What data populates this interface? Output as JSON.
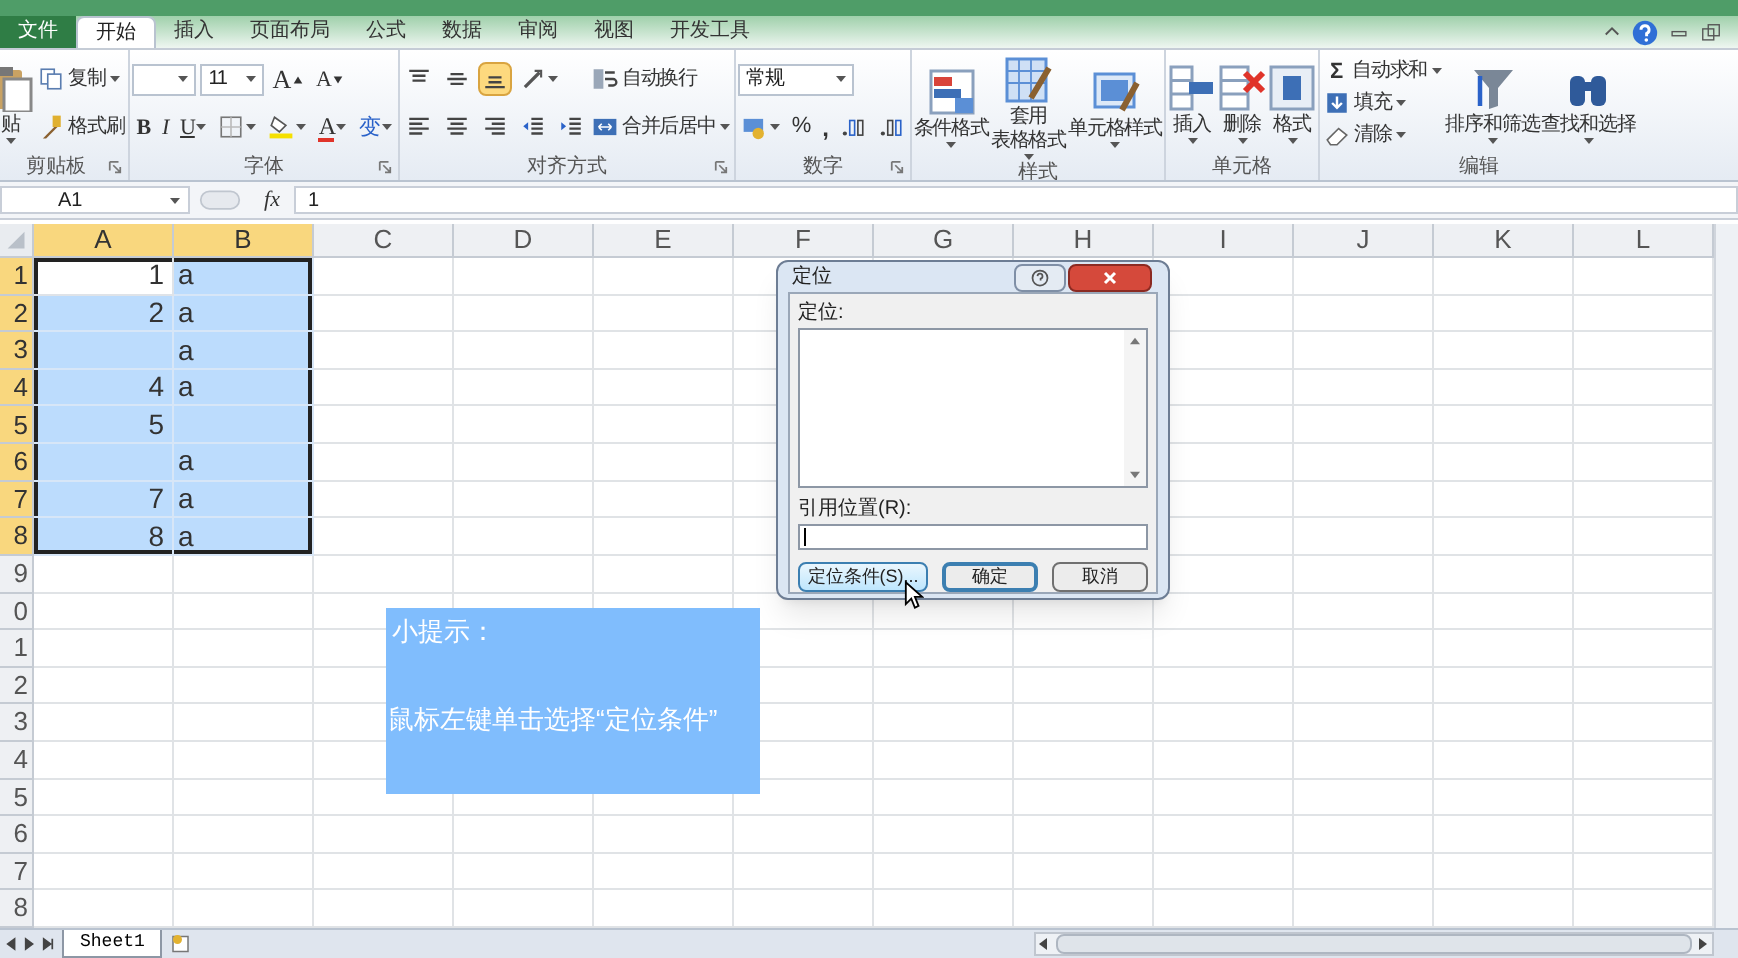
{
  "tabs": [
    {
      "label": "文件",
      "kind": "file",
      "selected": false
    },
    {
      "label": "开始",
      "kind": "tab",
      "selected": true
    },
    {
      "label": "插入",
      "kind": "tab",
      "selected": false
    },
    {
      "label": "页面布局",
      "kind": "tab",
      "selected": false
    },
    {
      "label": "公式",
      "kind": "tab",
      "selected": false
    },
    {
      "label": "数据",
      "kind": "tab",
      "selected": false
    },
    {
      "label": "审阅",
      "kind": "tab",
      "selected": false
    },
    {
      "label": "视图",
      "kind": "tab",
      "selected": false
    },
    {
      "label": "开发工具",
      "kind": "tab",
      "selected": false
    }
  ],
  "ribbon_groups": [
    {
      "label": "剪贴板",
      "launcher": true,
      "columns": [
        [
          [
            {
              "kind": "big",
              "label": "贴",
              "menu": true
            }
          ]
        ],
        [
          [
            {
              "kind": "small",
              "label": "复制",
              "menu": true
            }
          ],
          [
            {
              "kind": "small",
              "label": "格式刷",
              "menu": false
            }
          ]
        ]
      ]
    },
    {
      "label": "字体",
      "launcher": true,
      "columns": [
        [
          [
            {
              "kind": "field",
              "menu": true
            },
            {
              "kind": "field",
              "value": "11",
              "menu": true
            },
            {
              "kind": "glyph",
              "label": "A",
              "menu": false
            },
            {
              "kind": "glyph",
              "label": "A",
              "menu": false
            }
          ],
          [
            {
              "kind": "glyph",
              "label": "B",
              "menu": false
            },
            {
              "kind": "glyph",
              "label": "I",
              "menu": false
            },
            {
              "kind": "glyph",
              "label": "U",
              "menu": true
            },
            {
              "kind": "icon",
              "menu": true
            },
            {
              "kind": "icon",
              "menu": true
            },
            {
              "kind": "glyph",
              "label": "A",
              "menu": true
            },
            {
              "kind": "glyph",
              "label": "变",
              "menu": true
            }
          ]
        ]
      ]
    },
    {
      "label": "对齐方式",
      "launcher": true,
      "columns": [
        [
          [
            {
              "kind": "icon",
              "menu": false,
              "on": false
            },
            {
              "kind": "icon",
              "menu": false,
              "on": false
            },
            {
              "kind": "icon",
              "menu": false,
              "on": true
            },
            {
              "kind": "icon",
              "menu": true,
              "on": false
            }
          ],
          [
            {
              "kind": "icon",
              "menu": false,
              "on": false
            },
            {
              "kind": "icon",
              "menu": false,
              "on": false
            },
            {
              "kind": "icon",
              "menu": false,
              "on": false
            },
            {
              "kind": "icon",
              "menu": false,
              "on": false
            },
            {
              "kind": "icon",
              "menu": false,
              "on": false
            }
          ]
        ],
        [
          [
            {
              "kind": "small",
              "label": "自动换行",
              "menu": false
            }
          ],
          [
            {
              "kind": "small",
              "label": "合并后居中",
              "menu": true
            }
          ]
        ]
      ]
    },
    {
      "label": "数字",
      "launcher": true,
      "columns": [
        [
          [
            {
              "kind": "field",
              "value": "常规",
              "menu": true
            }
          ],
          [
            {
              "kind": "icon",
              "menu": true
            },
            {
              "kind": "glyph",
              "label": "%",
              "menu": false
            },
            {
              "kind": "glyph",
              "label": ",",
              "menu": false
            },
            {
              "kind": "icon",
              "menu": false
            },
            {
              "kind": "icon",
              "menu": false
            }
          ]
        ]
      ]
    },
    {
      "label": "样式",
      "launcher": false,
      "columns": [
        [
          [
            {
              "kind": "big",
              "label": "条件格式",
              "menu": true
            }
          ]
        ],
        [
          [
            {
              "kind": "big",
              "label": [
                "套用",
                "表格格式"
              ],
              "menu": true
            }
          ]
        ],
        [
          [
            {
              "kind": "big",
              "label": "单元格样式",
              "menu": true
            }
          ]
        ]
      ]
    },
    {
      "label": "单元格",
      "launcher": false,
      "columns": [
        [
          [
            {
              "kind": "big",
              "label": "插入",
              "menu": true
            }
          ]
        ],
        [
          [
            {
              "kind": "big",
              "label": "删除",
              "menu": true
            }
          ]
        ],
        [
          [
            {
              "kind": "big",
              "label": "格式",
              "menu": true
            }
          ]
        ]
      ]
    },
    {
      "label": "编辑",
      "launcher": false,
      "columns": [
        [
          [
            {
              "kind": "small",
              "glyph": "Σ",
              "label": "自动求和",
              "menu": true
            }
          ],
          [
            {
              "kind": "small",
              "label": "填充",
              "menu": true
            }
          ],
          [
            {
              "kind": "small",
              "label": "清除",
              "menu": true
            }
          ]
        ],
        [
          [
            {
              "kind": "big",
              "label": "排序和筛选",
              "menu": true
            }
          ]
        ],
        [
          [
            {
              "kind": "big",
              "label": "查找和选择",
              "menu": true
            }
          ]
        ]
      ]
    }
  ],
  "formula_bar": {
    "name_box": "A1",
    "fx": "fx",
    "value": "1"
  },
  "columns": [
    {
      "label": "A",
      "selected": true
    },
    {
      "label": "B",
      "selected": true
    },
    {
      "label": "C",
      "selected": false
    },
    {
      "label": "D",
      "selected": false
    },
    {
      "label": "E",
      "selected": false
    },
    {
      "label": "F",
      "selected": false
    },
    {
      "label": "G",
      "selected": false
    },
    {
      "label": "H",
      "selected": false
    },
    {
      "label": "I",
      "selected": false
    },
    {
      "label": "J",
      "selected": false
    },
    {
      "label": "K",
      "selected": false
    },
    {
      "label": "L",
      "selected": false
    }
  ],
  "rows": [
    {
      "header": "1",
      "selected": true,
      "cells": [
        {
          "value": "1",
          "kind": "number",
          "selected": true,
          "active": true
        },
        {
          "value": "a",
          "kind": "text",
          "selected": true,
          "active": false
        }
      ]
    },
    {
      "header": "2",
      "selected": true,
      "cells": [
        {
          "value": "2",
          "kind": "number",
          "selected": true,
          "active": false
        },
        {
          "value": "a",
          "kind": "text",
          "selected": true,
          "active": false
        }
      ]
    },
    {
      "header": "3",
      "selected": true,
      "cells": [
        {
          "selected": true,
          "active": false
        },
        {
          "value": "a",
          "kind": "text",
          "selected": true,
          "active": false
        }
      ]
    },
    {
      "header": "4",
      "selected": true,
      "cells": [
        {
          "value": "4",
          "kind": "number",
          "selected": true,
          "active": false
        },
        {
          "value": "a",
          "kind": "text",
          "selected": true,
          "active": false
        }
      ]
    },
    {
      "header": "5",
      "selected": true,
      "cells": [
        {
          "value": "5",
          "kind": "number",
          "selected": true,
          "active": false
        },
        {
          "selected": true,
          "active": false
        }
      ]
    },
    {
      "header": "6",
      "selected": true,
      "cells": [
        {
          "selected": true,
          "active": false
        },
        {
          "value": "a",
          "kind": "text",
          "selected": true,
          "active": false
        }
      ]
    },
    {
      "header": "7",
      "selected": true,
      "cells": [
        {
          "value": "7",
          "kind": "number",
          "selected": true,
          "active": false
        },
        {
          "value": "a",
          "kind": "text",
          "selected": true,
          "active": false
        }
      ]
    },
    {
      "header": "8",
      "selected": true,
      "cells": [
        {
          "value": "8",
          "kind": "number",
          "selected": true,
          "active": false
        },
        {
          "value": "a",
          "kind": "text",
          "selected": true,
          "active": false
        }
      ]
    },
    {
      "header": "9",
      "selected": false
    },
    {
      "header": "0",
      "selected": false
    },
    {
      "header": "1",
      "selected": false
    },
    {
      "header": "2",
      "selected": false
    },
    {
      "header": "3",
      "selected": false
    },
    {
      "header": "4",
      "selected": false
    },
    {
      "header": "5",
      "selected": false
    },
    {
      "header": "6",
      "selected": false
    },
    {
      "header": "7",
      "selected": false
    },
    {
      "header": "8",
      "selected": false
    }
  ],
  "tip": {
    "title": "小提示：",
    "text": "鼠标左键单击选择“定位条件”"
  },
  "dialog": {
    "title": "定位",
    "list_label": "定位:",
    "reference_label": "引用位置(R):",
    "buttons": [
      {
        "label": "定位条件(S)...",
        "kind": "hover"
      },
      {
        "label": "确定",
        "kind": "default"
      },
      {
        "label": "取消",
        "kind": "normal"
      }
    ]
  },
  "sheet_tabs": [
    {
      "label": "Sheet1",
      "selected": true
    }
  ]
}
